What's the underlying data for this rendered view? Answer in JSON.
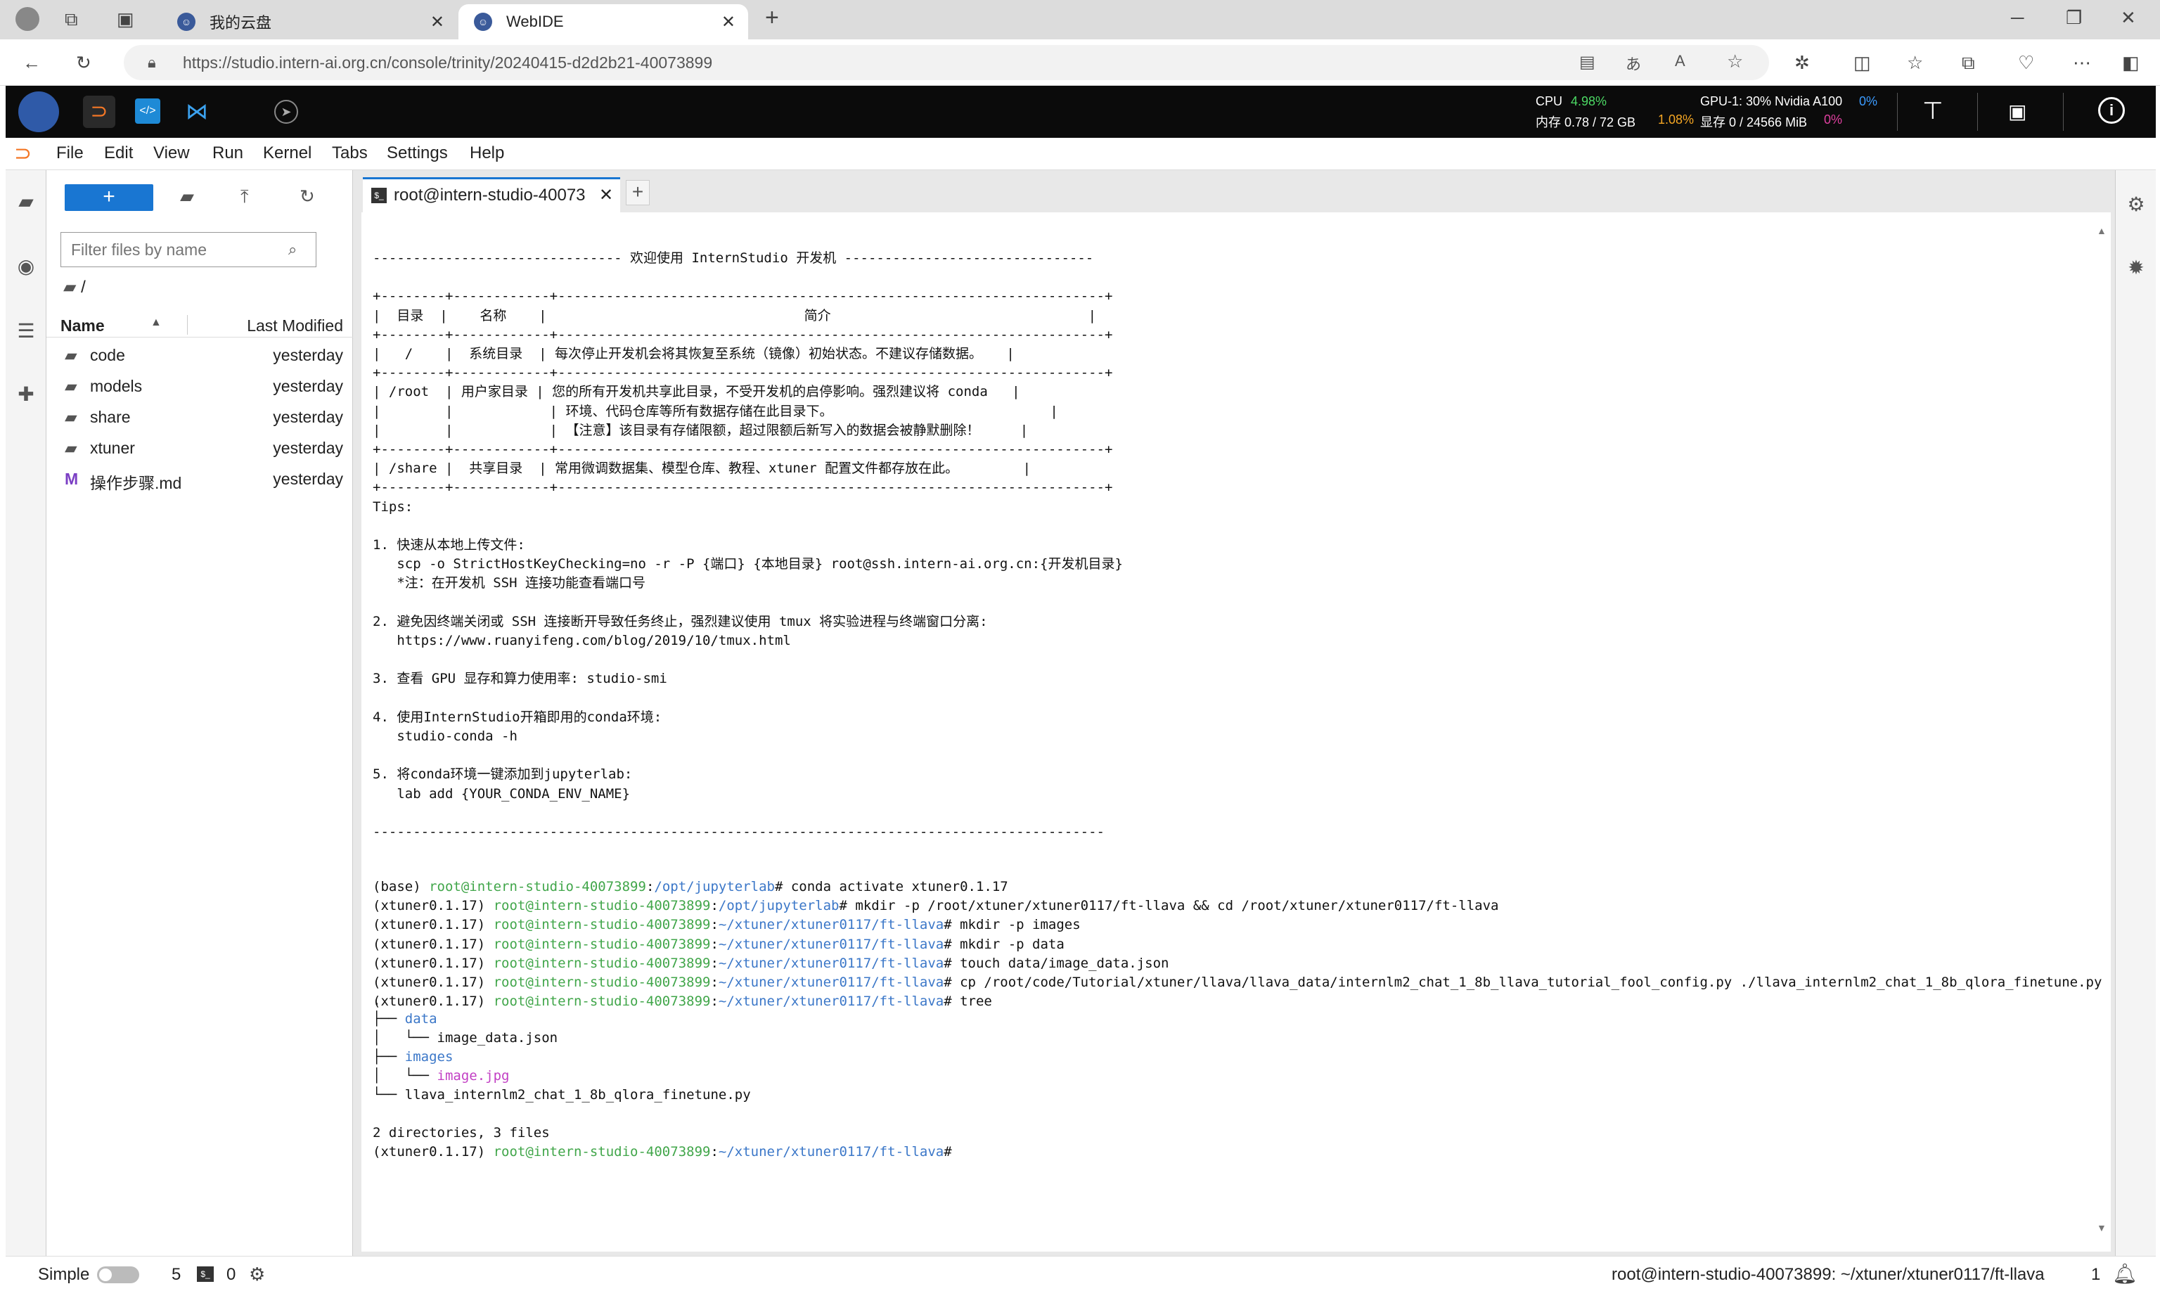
{
  "browser": {
    "tabs": [
      {
        "label": "我的云盘"
      },
      {
        "label": "WebIDE"
      }
    ],
    "url": "https://studio.intern-ai.org.cn/console/trinity/20240415-d2d2b21-40073899"
  },
  "header": {
    "cpu_label": "CPU",
    "cpu_value": "4.98%",
    "mem_label": "内存 0.78 / 72 GB",
    "mem_value": "1.08%",
    "gpu_label": "GPU-1: 30% Nvidia A100",
    "gpu_value": "0%",
    "vram_label": "显存 0 / 24566 MiB",
    "vram_value": "0%"
  },
  "menubar": [
    "File",
    "Edit",
    "View",
    "Run",
    "Kernel",
    "Tabs",
    "Settings",
    "Help"
  ],
  "filebrowser": {
    "new_label": "+",
    "filter_placeholder": "Filter files by name",
    "breadcrumb": "/",
    "col_name": "Name",
    "col_modified": "Last Modified",
    "files": [
      {
        "name": "code",
        "modified": "yesterday",
        "type": "folder"
      },
      {
        "name": "models",
        "modified": "yesterday",
        "type": "folder"
      },
      {
        "name": "share",
        "modified": "yesterday",
        "type": "folder"
      },
      {
        "name": "xtuner",
        "modified": "yesterday",
        "type": "folder"
      },
      {
        "name": "操作步骤.md",
        "modified": "yesterday",
        "type": "markdown"
      }
    ]
  },
  "terminal": {
    "tab_title": "root@intern-studio-40073",
    "banner": [
      "------------------------------- 欢迎使用 InternStudio 开发机 -------------------------------",
      "",
      "+--------+------------+--------------------------------------------------------------------+",
      "|  目录  |    名称    |                                简介                                |",
      "+--------+------------+--------------------------------------------------------------------+",
      "|   /    |  系统目录  | 每次停止开发机会将其恢复至系统（镜像）初始状态。不建议存储数据。   |",
      "+--------+------------+--------------------------------------------------------------------+",
      "| /root  | 用户家目录 | 您的所有开发机共享此目录，不受开发机的启停影响。强烈建议将 conda   |",
      "|        |            | 环境、代码仓库等所有数据存储在此目录下。                           |",
      "|        |            | 【注意】该目录有存储限额，超过限额后新写入的数据会被静默删除！     |",
      "+--------+------------+--------------------------------------------------------------------+",
      "| /share |  共享目录  | 常用微调数据集、模型仓库、教程、xtuner 配置文件都存放在此。        |",
      "+--------+------------+--------------------------------------------------------------------+",
      "Tips:",
      "",
      "1. 快速从本地上传文件:",
      "   scp -o StrictHostKeyChecking=no -r -P {端口} {本地目录} root@ssh.intern-ai.org.cn:{开发机目录}",
      "   *注：在开发机 SSH 连接功能查看端口号",
      "",
      "2. 避免因终端关闭或 SSH 连接断开导致任务终止，强烈建议使用 tmux 将实验进程与终端窗口分离:",
      "   https://www.ruanyifeng.com/blog/2019/10/tmux.html",
      "",
      "3. 查看 GPU 显存和算力使用率: studio-smi",
      "",
      "4. 使用InternStudio开箱即用的conda环境:",
      "   studio-conda -h",
      "",
      "5. 将conda环境一键添加到jupyterlab:",
      "   lab add {YOUR_CONDA_ENV_NAME}",
      "",
      "-------------------------------------------------------------------------------------------"
    ],
    "commands": [
      {
        "env": "(base) ",
        "host": "root@intern-studio-40073899",
        "path": "/opt/jupyterlab",
        "cmd": "# conda activate xtuner0.1.17"
      },
      {
        "env": "(xtuner0.1.17) ",
        "host": "root@intern-studio-40073899",
        "path": "/opt/jupyterlab",
        "cmd": "# mkdir -p /root/xtuner/xtuner0117/ft-llava && cd /root/xtuner/xtuner0117/ft-llava"
      },
      {
        "env": "(xtuner0.1.17) ",
        "host": "root@intern-studio-40073899",
        "path": "~/xtuner/xtuner0117/ft-llava",
        "cmd": "# mkdir -p images"
      },
      {
        "env": "(xtuner0.1.17) ",
        "host": "root@intern-studio-40073899",
        "path": "~/xtuner/xtuner0117/ft-llava",
        "cmd": "# mkdir -p data"
      },
      {
        "env": "(xtuner0.1.17) ",
        "host": "root@intern-studio-40073899",
        "path": "~/xtuner/xtuner0117/ft-llava",
        "cmd": "# touch data/image_data.json"
      },
      {
        "env": "(xtuner0.1.17) ",
        "host": "root@intern-studio-40073899",
        "path": "~/xtuner/xtuner0117/ft-llava",
        "cmd": "# cp /root/code/Tutorial/xtuner/llava/llava_data/internlm2_chat_1_8b_llava_tutorial_fool_config.py ./llava_internlm2_chat_1_8b_qlora_finetune.py"
      },
      {
        "env": "(xtuner0.1.17) ",
        "host": "root@intern-studio-40073899",
        "path": "~/xtuner/xtuner0117/ft-llava",
        "cmd": "# tree"
      }
    ],
    "tree": {
      "root": ".",
      "line_dir1_prefix": "├── ",
      "dir1": "data",
      "line_file1_prefix": "│   └── ",
      "file1": "image_data.json",
      "line_dir2_prefix": "├── ",
      "dir2": "images",
      "line_file2_prefix": "│   └── ",
      "file2": "image.jpg",
      "line_file3_prefix": "└── ",
      "file3": "llava_internlm2_chat_1_8b_qlora_finetune.py"
    },
    "summary": "2 directories, 3 files",
    "last_prompt": {
      "env": "(xtuner0.1.17) ",
      "host": "root@intern-studio-40073899",
      "path": "~/xtuner/xtuner0117/ft-llava",
      "cmd": "#"
    }
  },
  "statusbar": {
    "mode_label": "Simple",
    "terminals_count": "5",
    "kernels_count": "0",
    "path": "root@intern-studio-40073899: ~/xtuner/xtuner0117/ft-llava",
    "line": "1"
  },
  "colors": {
    "accent": "#1976d2",
    "prompt_host": "#41a64a",
    "prompt_path": "#3b77c8",
    "image_file": "#c23fc4"
  }
}
